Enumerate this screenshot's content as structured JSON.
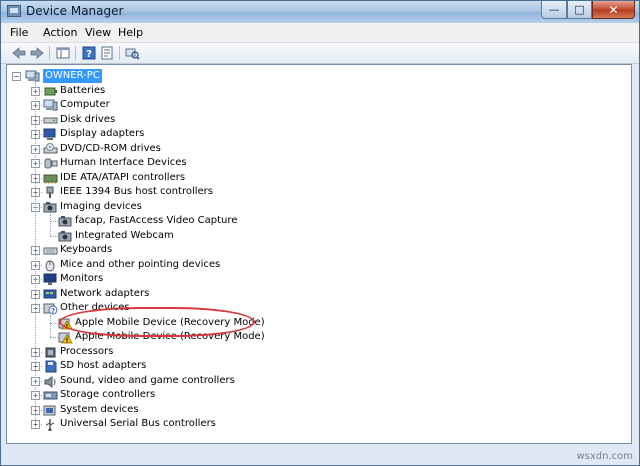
{
  "window": {
    "title": "Device Manager"
  },
  "window_controls": {
    "minimize": "—",
    "maximize": "□",
    "close": "✕"
  },
  "menu": [
    "File",
    "Action",
    "View",
    "Help"
  ],
  "toolbar_icons": [
    "back-arrow-icon",
    "forward-arrow-icon",
    "console-tree-icon",
    "help-icon",
    "properties-icon",
    "scan-hardware-icon"
  ],
  "tree": {
    "root": {
      "label": "OWNER-PC",
      "icon": "computer-icon",
      "selected": true
    },
    "items": [
      {
        "label": "Batteries",
        "icon": "battery-icon",
        "expanded": false
      },
      {
        "label": "Computer",
        "icon": "computer-icon",
        "expanded": false
      },
      {
        "label": "Disk drives",
        "icon": "disk-drive-icon",
        "expanded": false
      },
      {
        "label": "Display adapters",
        "icon": "display-adapter-icon",
        "expanded": false
      },
      {
        "label": "DVD/CD-ROM drives",
        "icon": "dvd-drive-icon",
        "expanded": false
      },
      {
        "label": "Human Interface Devices",
        "icon": "hid-icon",
        "expanded": false
      },
      {
        "label": "IDE ATA/ATAPI controllers",
        "icon": "ide-controller-icon",
        "expanded": false
      },
      {
        "label": "IEEE 1394 Bus host controllers",
        "icon": "firewire-icon",
        "expanded": false
      },
      {
        "label": "Imaging devices",
        "icon": "camera-icon",
        "expanded": true,
        "children": [
          {
            "label": "facap, FastAccess Video Capture",
            "icon": "camera-icon"
          },
          {
            "label": "Integrated Webcam",
            "icon": "camera-icon"
          }
        ]
      },
      {
        "label": "Keyboards",
        "icon": "keyboard-icon",
        "expanded": false
      },
      {
        "label": "Mice and other pointing devices",
        "icon": "mouse-icon",
        "expanded": false
      },
      {
        "label": "Monitors",
        "icon": "monitor-icon",
        "expanded": false
      },
      {
        "label": "Network adapters",
        "icon": "network-adapter-icon",
        "expanded": false
      },
      {
        "label": "Other devices",
        "icon": "unknown-device-icon",
        "expanded": true,
        "children": [
          {
            "label": "Apple Mobile Device (Recovery Mode)",
            "icon": "warning-device-icon"
          },
          {
            "label": "Apple Mobile Device (Recovery Mode)",
            "icon": "warning-device-icon"
          }
        ]
      },
      {
        "label": "Processors",
        "icon": "processor-icon",
        "expanded": false
      },
      {
        "label": "SD host adapters",
        "icon": "sd-adapter-icon",
        "expanded": false
      },
      {
        "label": "Sound, video and game controllers",
        "icon": "sound-icon",
        "expanded": false
      },
      {
        "label": "Storage controllers",
        "icon": "storage-controller-icon",
        "expanded": false
      },
      {
        "label": "System devices",
        "icon": "system-device-icon",
        "expanded": false
      },
      {
        "label": "Universal Serial Bus controllers",
        "icon": "usb-icon",
        "expanded": false
      }
    ]
  },
  "expander": {
    "collapsed": "+",
    "expanded": "−"
  },
  "colors": {
    "selection": "#3399ff",
    "highlight_ellipse": "#d8373d",
    "warning": "#f2c200"
  },
  "watermark": "wsxdn.com"
}
